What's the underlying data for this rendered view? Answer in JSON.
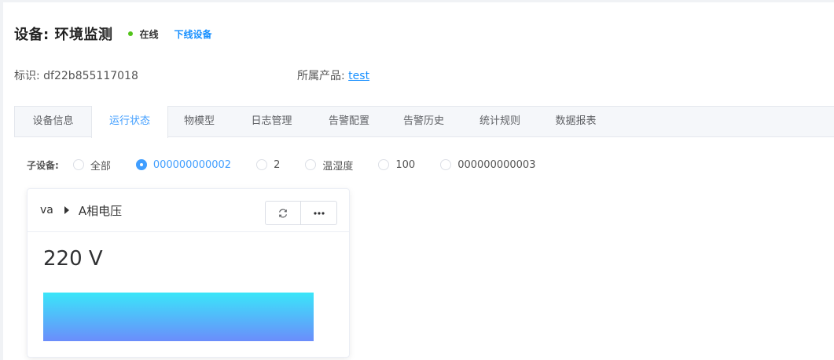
{
  "header": {
    "title": "设备: 环境监测",
    "status": "在线",
    "status_color": "#52c41a",
    "offline_action": "下线设备"
  },
  "meta": {
    "id_label": "标识: ",
    "id_value": "df22b855117018",
    "product_label": "所属产品: ",
    "product_value": "test"
  },
  "tabs": [
    {
      "label": "设备信息",
      "active": false
    },
    {
      "label": "运行状态",
      "active": true
    },
    {
      "label": "物模型",
      "active": false
    },
    {
      "label": "日志管理",
      "active": false
    },
    {
      "label": "告警配置",
      "active": false
    },
    {
      "label": "告警历史",
      "active": false
    },
    {
      "label": "统计规则",
      "active": false
    },
    {
      "label": "数据报表",
      "active": false
    }
  ],
  "subdevice": {
    "label": "子设备:",
    "options": [
      {
        "label": "全部",
        "checked": false
      },
      {
        "label": "000000000002",
        "checked": true
      },
      {
        "label": "2",
        "checked": false
      },
      {
        "label": "温湿度",
        "checked": false
      },
      {
        "label": "100",
        "checked": false
      },
      {
        "label": "000000000003",
        "checked": false
      }
    ]
  },
  "card": {
    "id": "va",
    "name": "A相电压",
    "value": "220 V",
    "refresh_icon": "refresh-icon",
    "more_icon": "more-icon",
    "gradient": [
      "#3ae6f9",
      "#6b8dfb"
    ]
  },
  "accent_color": "#409eff"
}
